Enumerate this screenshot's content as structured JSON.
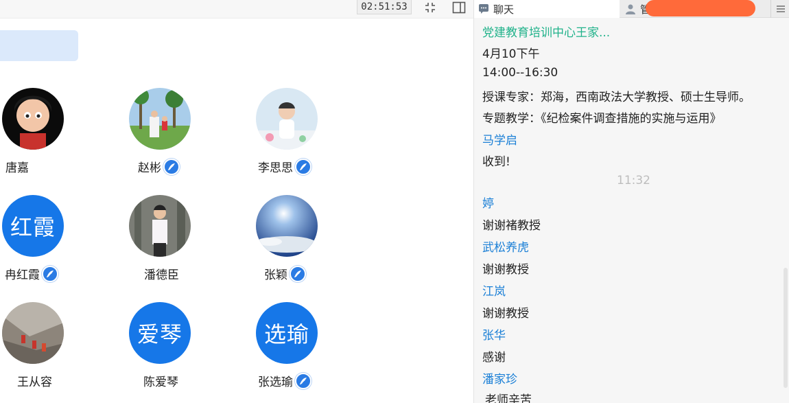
{
  "toolbar": {
    "timer": "02:51:53"
  },
  "members": [
    {
      "name": "唐嘉",
      "avatar": "photo",
      "badge": false
    },
    {
      "name": "赵彬",
      "avatar": "photo",
      "badge": true
    },
    {
      "name": "李思思",
      "avatar": "photo",
      "badge": true
    },
    {
      "name": "冉红霞",
      "avatar_text": "红霞",
      "badge": true
    },
    {
      "name": "潘德臣",
      "avatar": "photo",
      "badge": false
    },
    {
      "name": "张颖",
      "avatar": "photo",
      "badge": true
    },
    {
      "name": "王从容",
      "avatar": "photo",
      "badge": false
    },
    {
      "name": "陈爱琴",
      "avatar_text": "爱琴",
      "badge": false
    },
    {
      "name": "张选瑜",
      "avatar_text": "选瑜",
      "badge": true
    }
  ],
  "tabs": {
    "chat_label": "聊天",
    "manage_label": "管"
  },
  "chat": [
    {
      "kind": "sender",
      "text": "党建教育培训中心王家..."
    },
    {
      "kind": "msg",
      "text": "4月10下午"
    },
    {
      "kind": "msg",
      "text": "14:00--16:30"
    },
    {
      "kind": "msg",
      "text": "授课专家：郑海，西南政法大学教授、硕士生导师。"
    },
    {
      "kind": "msg",
      "text": "专题教学：《纪检案件调查措施的实施与运用》"
    },
    {
      "kind": "sender",
      "text": "马学启"
    },
    {
      "kind": "msg",
      "text": "收到!"
    },
    {
      "kind": "time",
      "text": "11:32"
    },
    {
      "kind": "sender",
      "text": "婷"
    },
    {
      "kind": "msg",
      "text": "谢谢褚教授"
    },
    {
      "kind": "sender",
      "text": "武松养虎"
    },
    {
      "kind": "msg",
      "text": "谢谢教授"
    },
    {
      "kind": "sender",
      "text": "江岚"
    },
    {
      "kind": "msg",
      "text": "谢谢教授"
    },
    {
      "kind": "sender",
      "text": "张华"
    },
    {
      "kind": "msg",
      "text": "感谢"
    },
    {
      "kind": "sender",
      "text": "潘家珍"
    },
    {
      "kind": "msg",
      "text": "老师辛苦"
    }
  ],
  "colors": {
    "accent": "#1677e8",
    "sender": "#1a7fd6",
    "first_sender": "#20b28a",
    "redaction": "#ff6a3a"
  },
  "icons": [
    "exit-fullscreen-icon",
    "sidebar-toggle-icon",
    "chat-icon",
    "user-icon",
    "menu-icon",
    "handwriting-badge-icon"
  ]
}
